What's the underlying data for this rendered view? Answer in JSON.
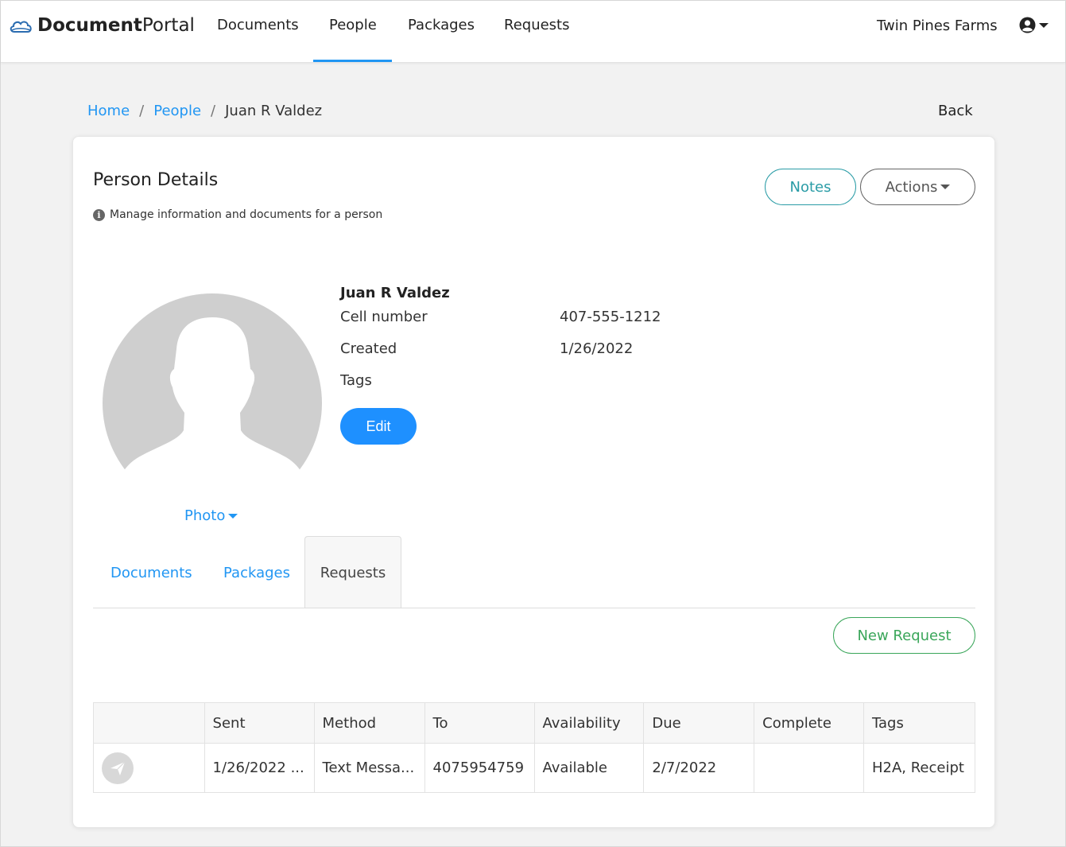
{
  "app": {
    "brand_strong": "Document",
    "brand_light": "Portal"
  },
  "nav": {
    "items": [
      {
        "label": "Documents"
      },
      {
        "label": "People"
      },
      {
        "label": "Packages"
      },
      {
        "label": "Requests"
      }
    ],
    "active": "People",
    "org_name": "Twin Pines Farms"
  },
  "breadcrumb": {
    "home": "Home",
    "people": "People",
    "current": "Juan R Valdez",
    "separator": "/"
  },
  "back_label": "Back",
  "card": {
    "title": "Person Details",
    "subtitle": "Manage information and documents for a person",
    "notes_label": "Notes",
    "actions_label": "Actions"
  },
  "person": {
    "name": "Juan R Valdez",
    "cell_label": "Cell number",
    "cell_value": "407-555-1212",
    "created_label": "Created",
    "created_value": "1/26/2022",
    "tags_label": "Tags",
    "edit_label": "Edit",
    "photo_label": "Photo"
  },
  "tabs": {
    "documents": "Documents",
    "packages": "Packages",
    "requests": "Requests",
    "active": "Requests"
  },
  "new_request_label": "New Request",
  "table": {
    "headers": [
      "",
      "Sent",
      "Method",
      "To",
      "Availability",
      "Due",
      "Complete",
      "Tags"
    ],
    "rows": [
      {
        "icon": "send-icon",
        "sent": "1/26/2022 ...",
        "method": "Text Messa...",
        "to": "4075954759",
        "availability": "Available",
        "due": "2/7/2022",
        "complete": "",
        "tags": "H2A, Receipt"
      }
    ]
  },
  "colors": {
    "primary": "#1e90ff",
    "link": "#2196f3",
    "teal": "#2a9ca6",
    "green": "#3aa65a"
  }
}
